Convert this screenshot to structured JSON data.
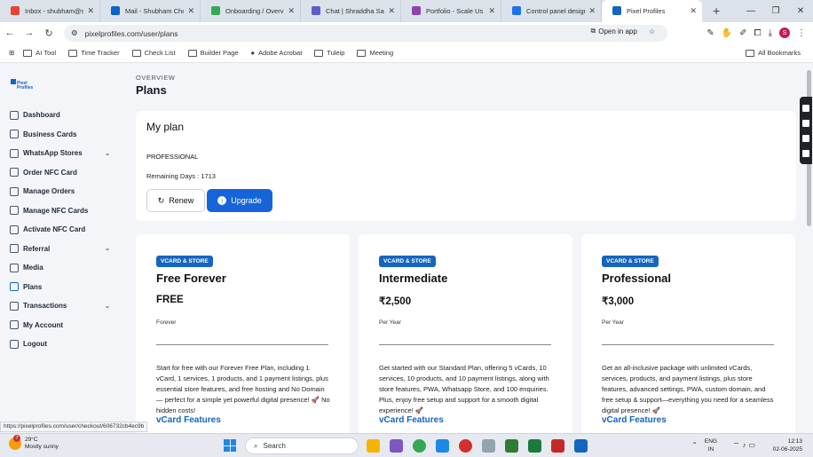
{
  "browser": {
    "tabs": [
      {
        "title": "Inbox - shubham@s",
        "color": "#ea4335"
      },
      {
        "title": "Mail - Shubham Cho",
        "color": "#0a64c8"
      },
      {
        "title": "Onboarding / Overvi",
        "color": "#34a853"
      },
      {
        "title": "Chat | Shraddha Sah",
        "color": "#5b5fc7"
      },
      {
        "title": "Portfolio - Scale Us",
        "color": "#8e44ad"
      },
      {
        "title": "Control panel design",
        "color": "#1a73e8"
      },
      {
        "title": "Pixel Profiles",
        "color": "#1565c0"
      }
    ],
    "url": "pixelprofiles.com/user/plans",
    "open_in_app": "Open in app",
    "profile_initial": "S",
    "bookmarks": [
      "AI Tool",
      "Time Tracker",
      "Check List",
      "Builder Page",
      "Adobe Acrobat",
      "Tuleip",
      "Meeting"
    ],
    "all_bookmarks": "All Bookmarks",
    "status_url": "https://pixelprofiles.com/user/checkout/606732cb4ec9b"
  },
  "logo": {
    "line1": "Pixel",
    "line2": "Profiles"
  },
  "sidebar": {
    "items": [
      {
        "label": "Dashboard"
      },
      {
        "label": "Business Cards"
      },
      {
        "label": "WhatsApp Stores",
        "chev": "⌄"
      },
      {
        "label": "Order NFC Card"
      },
      {
        "label": "Manage Orders"
      },
      {
        "label": "Manage NFC Cards"
      },
      {
        "label": "Activate NFC Card"
      },
      {
        "label": "Referral",
        "chev": "⌄"
      },
      {
        "label": "Media"
      },
      {
        "label": "Plans"
      },
      {
        "label": "Transactions",
        "chev": "⌄"
      },
      {
        "label": "My Account"
      },
      {
        "label": "Logout"
      }
    ]
  },
  "header": {
    "overview": "OVERVIEW",
    "title": "Plans"
  },
  "myplan": {
    "heading": "My plan",
    "plan_name": "PROFESSIONAL",
    "remaining": "Remaining Days : 1713",
    "renew": "Renew",
    "upgrade": "Upgrade"
  },
  "cards": [
    {
      "badge": "VCARD & STORE",
      "title": "Free Forever",
      "price": "FREE",
      "period": "Forever",
      "desc": "Start for free with our Forever Free Plan, including 1 vCard, 1 services, 1 products, and 1 payment listings, plus essential store features, and free hosting and No Domain — perfect for a simple yet powerful digital presence! 🚀 No hidden costs!",
      "features": "vCard Features"
    },
    {
      "badge": "VCARD & STORE",
      "title": "Intermediate",
      "price": "₹2,500",
      "period": "Per Year",
      "desc": "Get started with our Standard Plan, offering 5 vCards, 10 services, 10 products, and 10 payment listings, along with store features, PWA, Whatsapp Store, and 100 enquiries. Plus, enjoy free setup and support for a smooth digital experience! 🚀",
      "features": "vCard Features"
    },
    {
      "badge": "VCARD & STORE",
      "title": "Professional",
      "price": "₹3,000",
      "period": "Per Year",
      "desc": "Get an all-inclusive package with unlimited vCards, services, products, and payment listings, plus store features, advanced settings, PWA, custom domain, and free setup & support—everything you need for a seamless digital presence! 🚀",
      "features": "vCard Features"
    }
  ],
  "taskbar": {
    "temp": "29°C",
    "weather": "Mostly sunny",
    "notif_count": "7",
    "search": "Search",
    "lang1": "ENG",
    "lang2": "IN",
    "time": "12:13",
    "date": "02-06-2025"
  }
}
